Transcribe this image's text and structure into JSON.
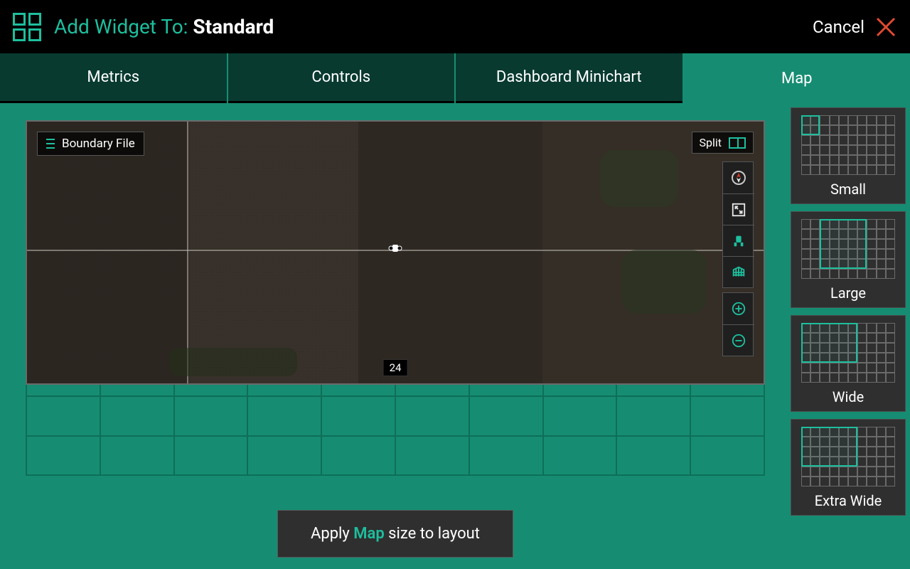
{
  "colors": {
    "accent": "#1dbf9e",
    "close": "#e04a2f"
  },
  "header": {
    "title_prefix": "Add Widget To: ",
    "title_value": "Standard",
    "cancel_label": "Cancel"
  },
  "tabs": [
    {
      "id": "metrics",
      "label": "Metrics",
      "active": false
    },
    {
      "id": "controls",
      "label": "Controls",
      "active": false
    },
    {
      "id": "minichart",
      "label": "Dashboard Minichart",
      "active": false
    },
    {
      "id": "map",
      "label": "Map",
      "active": true
    }
  ],
  "map_preview": {
    "boundary_label": "Boundary File",
    "split_label": "Split",
    "scale_label": "24",
    "toolbar": [
      {
        "id": "compass",
        "name": "compass-icon",
        "active": false
      },
      {
        "id": "fullscreen",
        "name": "fullscreen-icon",
        "active": false
      },
      {
        "id": "locate",
        "name": "vehicle-locate-icon",
        "active": true
      },
      {
        "id": "layers",
        "name": "grid-layers-icon",
        "active": false
      },
      {
        "id": "zoom-in",
        "name": "zoom-in-icon",
        "active": false
      },
      {
        "id": "zoom-out",
        "name": "zoom-out-icon",
        "active": false
      }
    ]
  },
  "apply_button": {
    "prefix": "Apply ",
    "accent": "Map",
    "suffix": " size to layout"
  },
  "size_options": [
    {
      "id": "small",
      "label": "Small",
      "hx": 0,
      "hy": 0,
      "hw": 2,
      "hh": 2,
      "selected": false
    },
    {
      "id": "large",
      "label": "Large",
      "hx": 2,
      "hy": 0,
      "hw": 5,
      "hh": 5,
      "selected": false
    },
    {
      "id": "wide",
      "label": "Wide",
      "hx": 0,
      "hy": 0,
      "hw": 6,
      "hh": 4,
      "selected": false
    },
    {
      "id": "xwide",
      "label": "Extra Wide",
      "hx": 0,
      "hy": 0,
      "hw": 6,
      "hh": 4,
      "selected": false
    }
  ]
}
